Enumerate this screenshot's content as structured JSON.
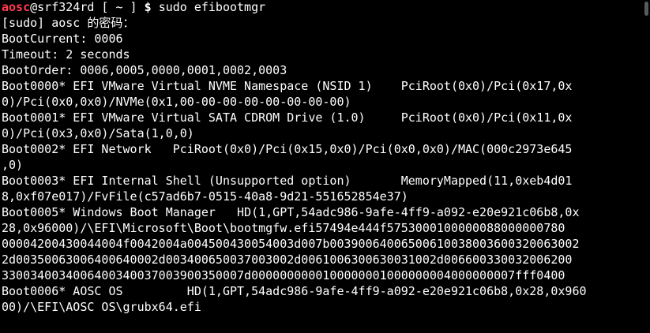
{
  "prompt": {
    "user": "aosc",
    "host_path": "@srf324rd [ ~ ] ",
    "sign": "$ ",
    "command": "sudo efibootmgr"
  },
  "colors": {
    "background": "#000000",
    "foreground": "#ffffff",
    "user": "#ff3b4e"
  },
  "output": [
    "[sudo] aosc 的密码：",
    "BootCurrent: 0006",
    "Timeout: 2 seconds",
    "BootOrder: 0006,0005,0000,0001,0002,0003",
    "Boot0000* EFI VMware Virtual NVME Namespace (NSID 1)    PciRoot(0x0)/Pci(0x17,0x",
    "0)/Pci(0x0,0x0)/NVMe(0x1,00-00-00-00-00-00-00-00)",
    "Boot0001* EFI VMware Virtual SATA CDROM Drive (1.0)     PciRoot(0x0)/Pci(0x11,0x",
    "0)/Pci(0x3,0x0)/Sata(1,0,0)",
    "Boot0002* EFI Network   PciRoot(0x0)/Pci(0x15,0x0)/Pci(0x0,0x0)/MAC(000c2973e645",
    ",0)",
    "Boot0003* EFI Internal Shell (Unsupported option)       MemoryMapped(11,0xeb4d01",
    "8,0xf07e017)/FvFile(c57ad6b7-0515-40a8-9d21-551652854e37)",
    "Boot0005* Windows Boot Manager   HD(1,GPT,54adc986-9afe-4ff9-a092-e20e921c06b8,0x",
    "28,0x96000)/\\EFI\\Microsoft\\Boot\\bootmgfw.efi57494e444f5753000100000088000000780",
    "00004200430044004f0042004a004500430054003d007b00390064006500610038003600320063002",
    "2d00350063006400640002d003400650037003002d0061006300630031002d006600330032006200",
    "3300340034006400340037003900350007d0000000000100000001000000004000000007fff0400",
    "Boot0006* AOSC OS         HD(1,GPT,54adc986-9afe-4ff9-a092-e20e921c06b8,0x28,0x960",
    "00)/\\EFI\\AOSC OS\\grubx64.efi"
  ]
}
